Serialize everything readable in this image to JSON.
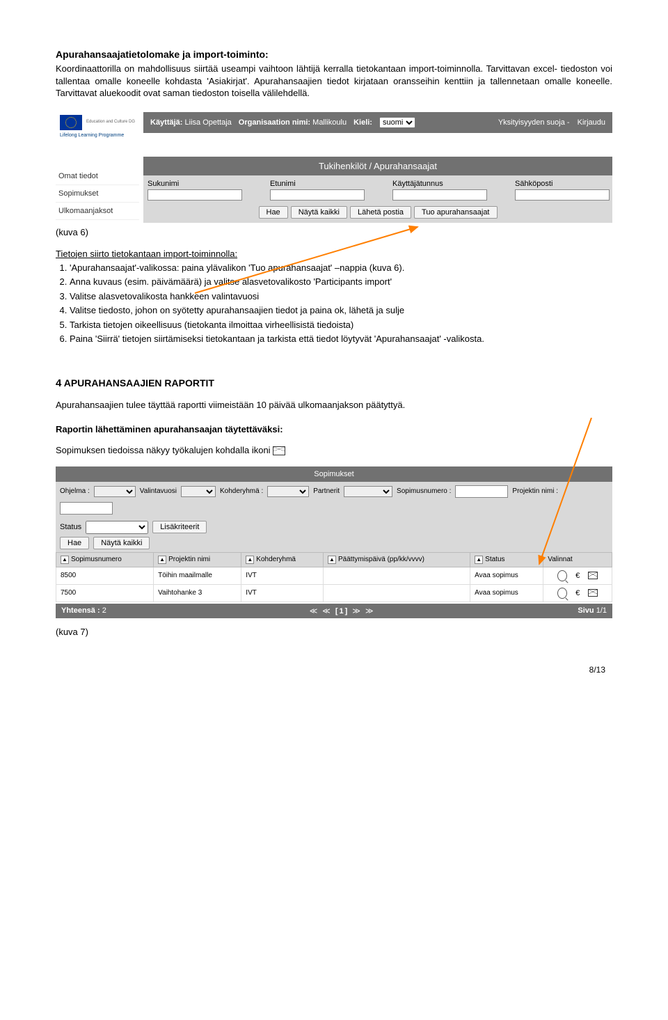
{
  "doc": {
    "section_title": "Apurahansaajatietolomake ja import-toiminto:",
    "para1": "Koordinaattorilla on mahdollisuus siirtää useampi vaihtoon lähtijä kerralla tietokantaan import-toiminnolla. Tarvittavan excel- tiedoston voi tallentaa omalle koneelle kohdasta 'Asiakirjat'. Apurahansaajien tiedot kirjataan oransseihin kenttiin ja tallennetaan omalle koneelle. Tarvittavat aluekoodit ovat saman tiedoston toisella välilehdellä.",
    "kuva6": "(kuva 6)",
    "instr_heading": "Tietojen siirto tietokantaan import-toiminnolla:",
    "steps": [
      "'Apurahansaajat'-valikossa: paina ylävalikon 'Tuo apurahansaajat' –nappia (kuva 6).",
      "Anna kuvaus (esim. päivämäärä) ja valitse alasvetovalikosto 'Participants import'",
      "Valitse alasvetovalikosta hankkeen valintavuosi",
      "Valitse tiedosto, johon on syötetty apurahansaajien tiedot ja paina ok, lähetä ja sulje",
      "Tarkista tietojen oikeellisuus (tietokanta ilmoittaa virheellisistä tiedoista)",
      "Paina 'Siirrä' tietojen siirtämiseksi tietokantaan ja tarkista että tiedot löytyvät 'Apurahansaajat' -valikosta."
    ],
    "section4_num": "4",
    "section4_title": "APURAHANSAAJIEN RAPORTIT",
    "para2": "Apurahansaajien tulee täyttää raportti viimeistään 10 päivää ulkomaanjakson päätyttyä.",
    "bold_line": "Raportin lähettäminen apurahansaajan täytettäväksi:",
    "para3": "Sopimuksen tiedoissa näkyy työkalujen kohdalla ikoni",
    "kuva7": "(kuva 7)",
    "page_num": "8/13"
  },
  "app": {
    "header": {
      "user_label": "Käyttäjä:",
      "user_value": "Liisa Opettaja",
      "org_label": "Organisaation nimi:",
      "org_value": "Mallikoulu",
      "lang_label": "Kieli:",
      "lang_value": "suomi",
      "link_privacy": "Yksityisyyden suoja",
      "link_logout": "Kirjaudu"
    },
    "logos": {
      "ec": "Education and Culture DG",
      "llp": "Lifelong Learning Programme"
    },
    "section_bar": "Tukihenkilöt / Apurahansaajat",
    "nav": {
      "n1": "Omat tiedot",
      "n2": "Sopimukset",
      "n3": "Ulkomaanjaksot"
    },
    "filters": {
      "f1": "Sukunimi",
      "f2": "Etunimi",
      "f3": "Käyttäjätunnus",
      "f4": "Sähköposti"
    },
    "buttons": {
      "b1": "Hae",
      "b2": "Näytä kaikki",
      "b3": "Lähetä postia",
      "b4": "Tuo apurahansaajat"
    }
  },
  "contracts": {
    "bar": "Sopimukset",
    "filters": {
      "prog": "Ohjelma :",
      "year": "Valintavuosi",
      "group": "Kohderyhmä :",
      "partners": "Partnerit",
      "contract_no": "Sopimusnumero :",
      "project": "Projektin nimi :",
      "status": "Status",
      "extra": "Lisäkriteerit"
    },
    "buttons": {
      "b1": "Hae",
      "b2": "Näytä kaikki"
    },
    "headers": {
      "h1": "Sopimusnumero",
      "h2": "Projektin nimi",
      "h3": "Kohderyhmä",
      "h4": "Päättymispäivä (pp/kk/vvvv)",
      "h5": "Status",
      "h6": "Valinnat"
    },
    "rows": [
      {
        "num": "8500",
        "name": "Töihin maailmalle",
        "group": "IVT",
        "end": "",
        "status": "Avaa sopimus"
      },
      {
        "num": "7500",
        "name": "Vaihtohanke 3",
        "group": "IVT",
        "end": "",
        "status": "Avaa sopimus"
      }
    ],
    "footer": {
      "total_label": "Yhteensä :",
      "total_value": "2",
      "paging": "[1]",
      "page_label": "Sivu",
      "page_value": "1/1"
    }
  }
}
